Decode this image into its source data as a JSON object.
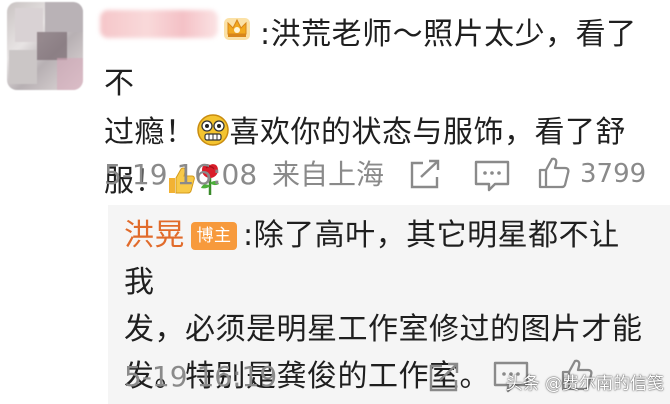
{
  "comment": {
    "text_line1": ":洪荒老师～照片太少，看了不",
    "text_line2_a": "过瘾！",
    "text_line2_b": "喜欢你的状态与服饰，看了舒",
    "text_line3": "服！",
    "time": "5-19 16:08",
    "location": "来自上海",
    "like_count": "3799"
  },
  "reply": {
    "author": "洪晃",
    "badge": "博主",
    "text_line1": ":除了高叶，其它明星都不让我",
    "text_line2": "发，必须是明星工作室修过的图片才能",
    "text_line3": "发。特别是龚俊的工作室。",
    "time": "5-19 16:19"
  },
  "watermark": "头条 @费尔南的信笺",
  "icons": {
    "crown": "crown-badge-icon",
    "emoji_face": "grimace-emoji-icon",
    "thumb": "thumbs-up-emoji-icon",
    "rose": "rose-emoji-icon",
    "share": "share-icon",
    "comment": "comment-icon",
    "like": "like-icon"
  },
  "colors": {
    "author": "#e16b2b",
    "badge": "#f79a3c",
    "meta": "#8a8a8a",
    "reply_bg": "#f5f5f5"
  }
}
